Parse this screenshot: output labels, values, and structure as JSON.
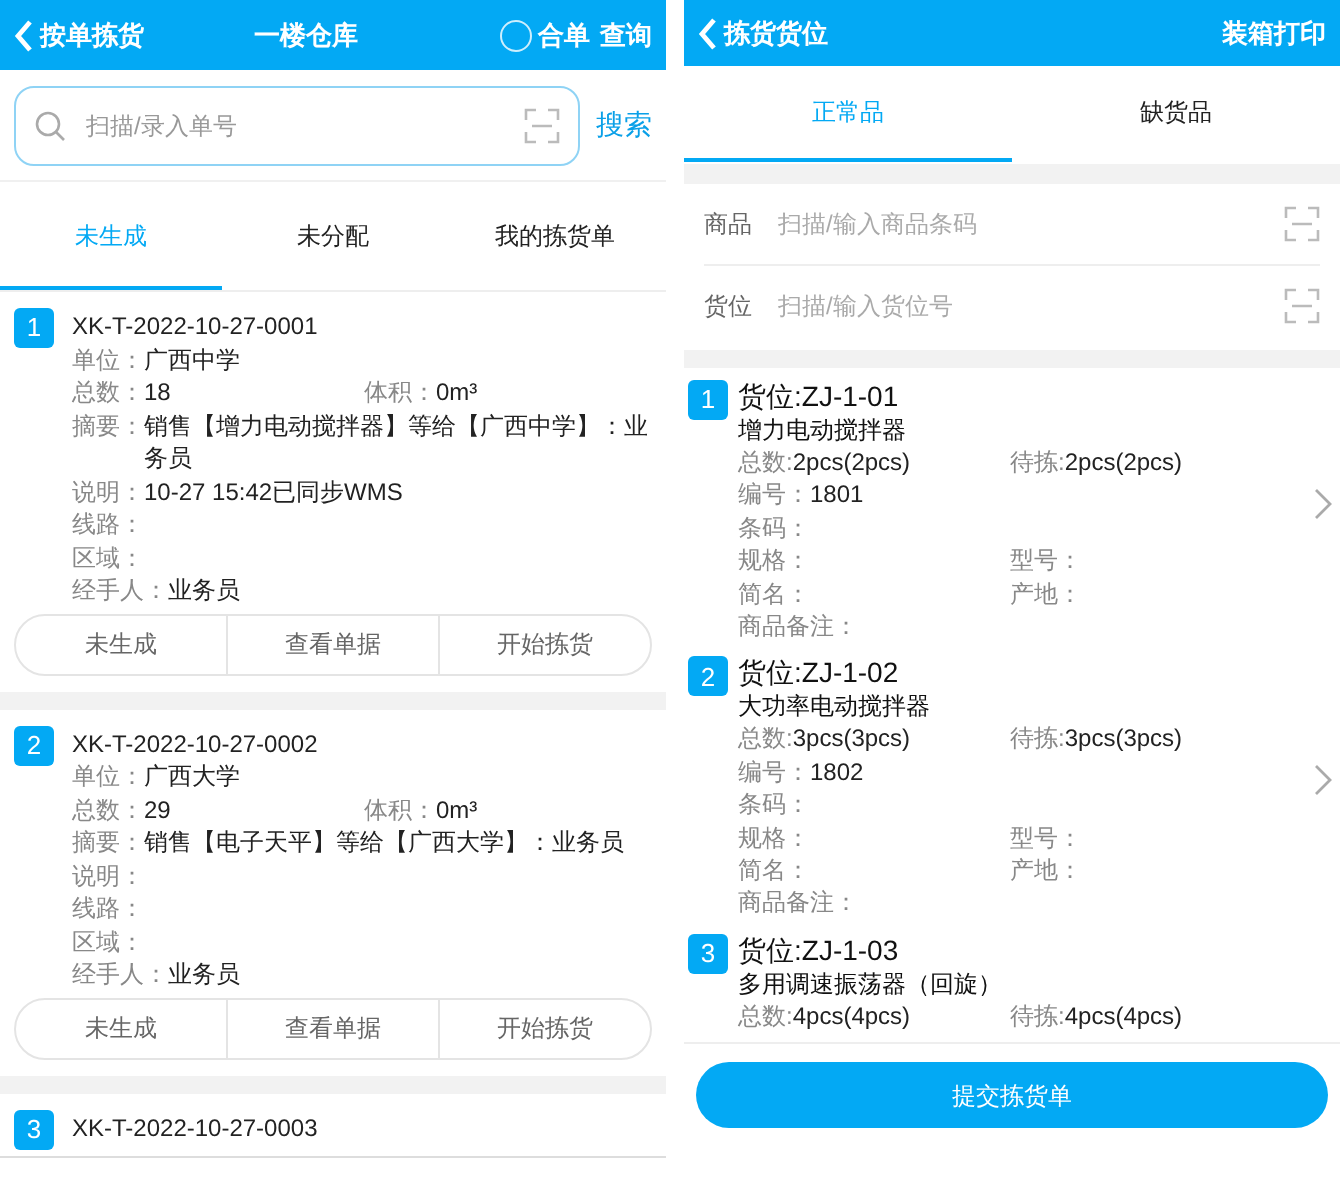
{
  "left": {
    "header": {
      "back_label": "按单拣货",
      "title": "一楼仓库",
      "merge": {
        "label": "合单",
        "checked": false
      },
      "query": "查询"
    },
    "search": {
      "placeholder": "扫描/录入单号",
      "button": "搜索"
    },
    "tabs": [
      {
        "label": "未生成",
        "selected": true
      },
      {
        "label": "未分配",
        "selected": false
      },
      {
        "label": "我的拣货单",
        "selected": false
      }
    ],
    "orders": [
      {
        "index": "1",
        "number": "XK-T-2022-10-27-0001",
        "rows": [
          [
            {
              "label": "单位：",
              "value": "广西中学"
            }
          ],
          [
            {
              "label": "总数：",
              "value": "18"
            },
            {
              "label": "体积：",
              "value": "0m³"
            }
          ],
          [
            {
              "label": "摘要：",
              "value": "销售【增力电动搅拌器】等给【广西中学】：业务员"
            }
          ],
          [
            {
              "label": "说明：",
              "value": "10-27 15:42已同步WMS"
            }
          ],
          [
            {
              "label": "线路："
            }
          ],
          [
            {
              "label": "区域："
            }
          ],
          [
            {
              "label": "经手人：",
              "value": "业务员"
            }
          ]
        ],
        "actions": [
          "未生成",
          "查看单据",
          "开始拣货"
        ]
      },
      {
        "index": "2",
        "number": "XK-T-2022-10-27-0002",
        "rows": [
          [
            {
              "label": "单位：",
              "value": "广西大学"
            }
          ],
          [
            {
              "label": "总数：",
              "value": "29"
            },
            {
              "label": "体积：",
              "value": "0m³"
            }
          ],
          [
            {
              "label": "摘要：",
              "value": "销售【电子天平】等给【广西大学】：业务员"
            }
          ],
          [
            {
              "label": "说明："
            }
          ],
          [
            {
              "label": "线路："
            }
          ],
          [
            {
              "label": "区域："
            }
          ],
          [
            {
              "label": "经手人：",
              "value": "业务员"
            }
          ]
        ],
        "actions": [
          "未生成",
          "查看单据",
          "开始拣货"
        ]
      },
      {
        "index": "3",
        "number": "XK-T-2022-10-27-0003"
      }
    ]
  },
  "right": {
    "header": {
      "back_label": "拣货货位",
      "action": "装箱打印"
    },
    "tabs": [
      {
        "label": "正常品",
        "selected": true
      },
      {
        "label": "缺货品",
        "selected": false
      }
    ],
    "inputs": [
      {
        "label": "商品",
        "placeholder": "扫描/输入商品条码"
      },
      {
        "label": "货位",
        "placeholder": "扫描/输入货位号"
      }
    ],
    "locations": [
      {
        "index": "1",
        "location": "货位:ZJ-1-01",
        "product": "增力电动搅拌器",
        "rows": [
          [
            {
              "label": "总数:",
              "value": "2pcs(2pcs)"
            },
            {
              "label": "待拣:",
              "value": "2pcs(2pcs)"
            }
          ],
          [
            {
              "label": "编号：",
              "value": "1801"
            }
          ],
          [
            {
              "label": "条码："
            }
          ],
          [
            {
              "label": "规格："
            },
            {
              "label": "型号："
            }
          ],
          [
            {
              "label": "简名："
            },
            {
              "label": "产地："
            }
          ],
          [
            {
              "label": "商品备注："
            }
          ]
        ]
      },
      {
        "index": "2",
        "location": "货位:ZJ-1-02",
        "product": "大功率电动搅拌器",
        "rows": [
          [
            {
              "label": "总数:",
              "value": "3pcs(3pcs)"
            },
            {
              "label": "待拣:",
              "value": "3pcs(3pcs)"
            }
          ],
          [
            {
              "label": "编号：",
              "value": "1802"
            }
          ],
          [
            {
              "label": "条码："
            }
          ],
          [
            {
              "label": "规格："
            },
            {
              "label": "型号："
            }
          ],
          [
            {
              "label": "简名："
            },
            {
              "label": "产地："
            }
          ],
          [
            {
              "label": "商品备注："
            }
          ]
        ]
      },
      {
        "index": "3",
        "location": "货位:ZJ-1-03",
        "product": "多用调速振荡器（回旋）",
        "rows": [
          [
            {
              "label": "总数:",
              "value": "4pcs(4pcs)"
            },
            {
              "label": "待拣:",
              "value": "4pcs(4pcs)"
            }
          ]
        ]
      }
    ],
    "submit": "提交拣货单"
  }
}
